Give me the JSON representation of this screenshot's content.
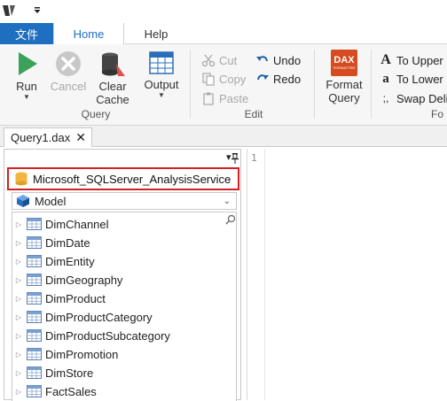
{
  "titlebar": {
    "app_icon": "daxstudio-logo",
    "qat_icon": "chevron-down-icon"
  },
  "ribbon_tabs": {
    "file": "文件",
    "home": "Home",
    "help": "Help"
  },
  "ribbon": {
    "run": "Run",
    "cancel": "Cancel",
    "clear_cache": "Clear Cache",
    "output": "Output",
    "group_query": "Query",
    "cut": "Cut",
    "copy": "Copy",
    "paste": "Paste",
    "undo": "Undo",
    "redo": "Redo",
    "group_edit": "Edit",
    "format_query": "Format Query",
    "dax_badge": "DAX",
    "dax_badge_sub": "FORMATTER",
    "to_upper": "To Upper",
    "to_lower": "To Lower",
    "swap_delims": "Swap Deli",
    "group_format": "Fo"
  },
  "document_tab": {
    "label": "Query1.dax",
    "close": "✕"
  },
  "metadata_pane": {
    "pin": "⊤",
    "dropdown": "▾",
    "connection": "Microsoft_SQLServer_AnalysisService",
    "model": "Model",
    "tables": [
      "DimChannel",
      "DimDate",
      "DimEntity",
      "DimGeography",
      "DimProduct",
      "DimProductCategory",
      "DimProductSubcategory",
      "DimPromotion",
      "DimStore",
      "FactSales"
    ]
  },
  "editor": {
    "line_numbers": [
      "1"
    ]
  },
  "colors": {
    "accent": "#1f6fc0",
    "highlight_border": "#d42020",
    "run_green": "#3aa05a"
  }
}
